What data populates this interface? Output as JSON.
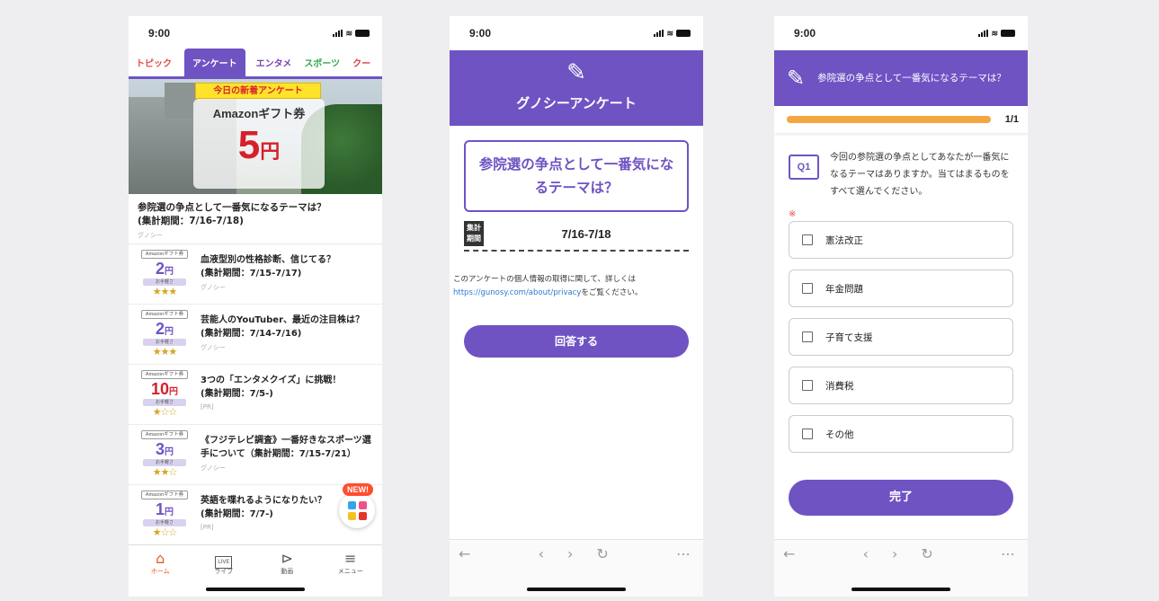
{
  "screen1": {
    "status_time": "9:00",
    "tabs": [
      "トピック",
      "アンケート",
      "エンタメ",
      "スポーツ",
      "クー"
    ],
    "banner": {
      "ribbon": "今日の新着アンケート",
      "gift_name": "Amazonギフト券",
      "amount": "5",
      "unit": "円"
    },
    "featured": {
      "title": "参院選の争点として一番気になるテーマは？",
      "period": "(集計期間：7/16-7/18)",
      "source": "グノシー"
    },
    "items": [
      {
        "amount": "2",
        "title": "血液型別の性格診断、信じてる？",
        "period": "(集計期間：7/15-7/17)",
        "source": "グノシー",
        "stars": "★★★"
      },
      {
        "amount": "2",
        "title": "芸能人のYouTuber、最近の注目株は？",
        "period": "(集計期間：7/14-7/16)",
        "source": "グノシー",
        "stars": "★★★"
      },
      {
        "amount": "10",
        "title": "3つの「エンタメクイズ」に挑戦！",
        "period": "(集計期間：7/5-)",
        "source": "[PR]",
        "stars": "★☆☆"
      },
      {
        "amount": "3",
        "title": "《フジテレビ調査》一番好きなスポーツ選手について（集計期間：7/15-7/21）",
        "period": "",
        "source": "グノシー",
        "stars": "★★☆"
      },
      {
        "amount": "1",
        "title": "英語を喋れるようになりたい？",
        "period": "(集計期間：7/7-)",
        "source": "[PR]",
        "stars": "★☆☆"
      }
    ],
    "badge_label": "Amazonギフト券",
    "badge_bar": "お手軽さ",
    "yen": "円",
    "new_label": "NEW!",
    "nav": [
      "ホーム",
      "ライブ",
      "動画",
      "メニュー"
    ],
    "live_icon": "LIVE"
  },
  "screen2": {
    "status_time": "9:00",
    "header_title": "グノシーアンケート",
    "question": "参院選の争点として一番気になるテーマは？",
    "period_label": "集計期間",
    "period": "7/16-7/18",
    "privacy_text": "このアンケートの個人情報の取得に関して、詳しくは",
    "privacy_link": "https://gunosy.com/about/privacy",
    "privacy_tail": "をご覧ください。",
    "answer_button": "回答する"
  },
  "screen3": {
    "status_time": "9:00",
    "header_title": "参院選の争点として一番気になるテーマは？",
    "progress_label": "1/1",
    "progress_fraction": 1.0,
    "q_tag": "Q1",
    "question": "今回の参院選の争点としてあなたが一番気になるテーマはありますか。当てはまるものをすべて選んでください。",
    "required_mark": "※",
    "options": [
      "憲法改正",
      "年金問題",
      "子育て支援",
      "消費税",
      "その他"
    ],
    "done_button": "完了"
  },
  "colors": {
    "purple": "#6f53c3",
    "orange": "#f4a640",
    "home_active": "#e35d1f"
  }
}
